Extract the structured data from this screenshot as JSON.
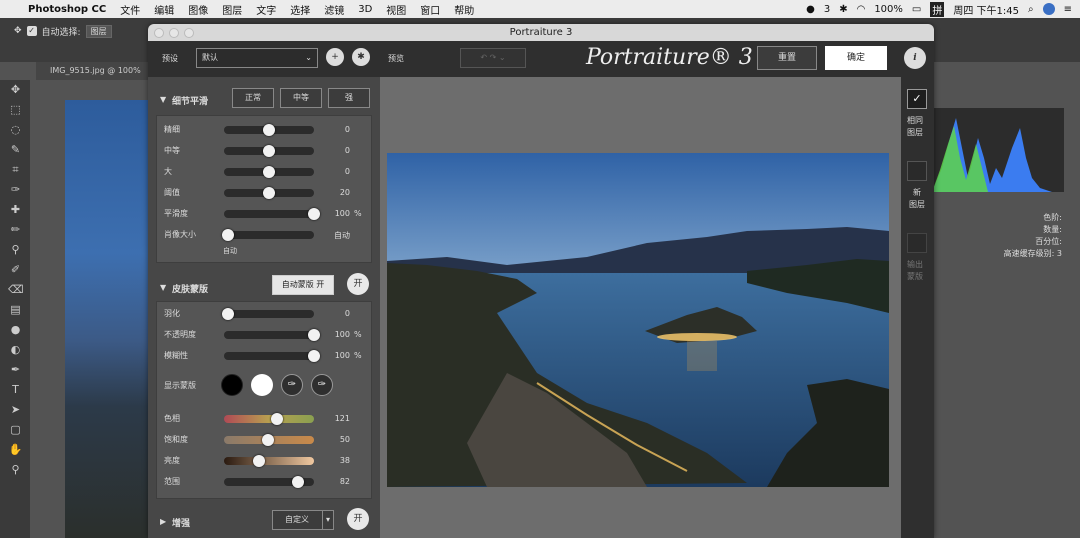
{
  "menubar": {
    "app": "Photoshop CC",
    "items": [
      "文件",
      "编辑",
      "图像",
      "图层",
      "文字",
      "选择",
      "滤镜",
      "3D",
      "视图",
      "窗口",
      "帮助"
    ],
    "status": {
      "notif": "3",
      "battery": "100%",
      "clock": "周四 下午1:45",
      "ime": "拼"
    }
  },
  "ps": {
    "auto_select_label": "自动选择:",
    "auto_select_value": "图层",
    "doc_tab": "IMG_9515.jpg @ 100%",
    "info_lines": [
      "色阶:",
      "数量:",
      "百分位:",
      "高速缓存级别:  3"
    ],
    "info_zero": "0"
  },
  "plugin": {
    "title": "Portraiture 3",
    "logo": "Portraiture® 3",
    "preset_label": "预设",
    "preset_value": "默认",
    "preview_label": "预览",
    "reset_label": "重置",
    "ok_label": "确定",
    "info_glyph": "i",
    "add_glyph": "+",
    "gear_glyph": "✱",
    "detail": {
      "title": "细节平滑",
      "modes": [
        "正常",
        "中等",
        "强"
      ],
      "sliders": [
        {
          "label": "精细",
          "value": "0",
          "pos": 0.5
        },
        {
          "label": "中等",
          "value": "0",
          "pos": 0.5
        },
        {
          "label": "大",
          "value": "0",
          "pos": 0.5
        },
        {
          "label": "阈值",
          "value": "20",
          "pos": 0.5
        },
        {
          "label": "平滑度",
          "value": "100",
          "unit": "%",
          "pos": 1.0
        },
        {
          "label": "肖像大小",
          "value": "自动",
          "pos": 0.04
        }
      ],
      "auto_caption": "自动"
    },
    "skin": {
      "title": "皮肤蒙版",
      "auto_button": "自动蒙版 开",
      "toggle": "开",
      "sliders": [
        {
          "label": "羽化",
          "value": "0",
          "pos": 0.04
        },
        {
          "label": "不透明度",
          "value": "100",
          "unit": "%",
          "pos": 1.0
        },
        {
          "label": "模糊性",
          "value": "100",
          "unit": "%",
          "pos": 1.0
        }
      ],
      "show_mask_label": "显示蒙版",
      "color_sliders": [
        {
          "label": "色相",
          "value": "121",
          "pos": 0.59
        },
        {
          "label": "饱和度",
          "value": "50",
          "pos": 0.49
        },
        {
          "label": "亮度",
          "value": "38",
          "pos": 0.39
        },
        {
          "label": "范围",
          "value": "82",
          "pos": 0.82
        }
      ]
    },
    "enhance": {
      "title": "增强",
      "custom": "自定义",
      "toggle": "开"
    },
    "side": {
      "same_layer": [
        "相同",
        "图层"
      ],
      "new_layer": [
        "新",
        "图层"
      ],
      "output_mask": [
        "输出",
        "蒙版"
      ]
    }
  },
  "colors": {
    "accent": "#2d5c9c"
  }
}
